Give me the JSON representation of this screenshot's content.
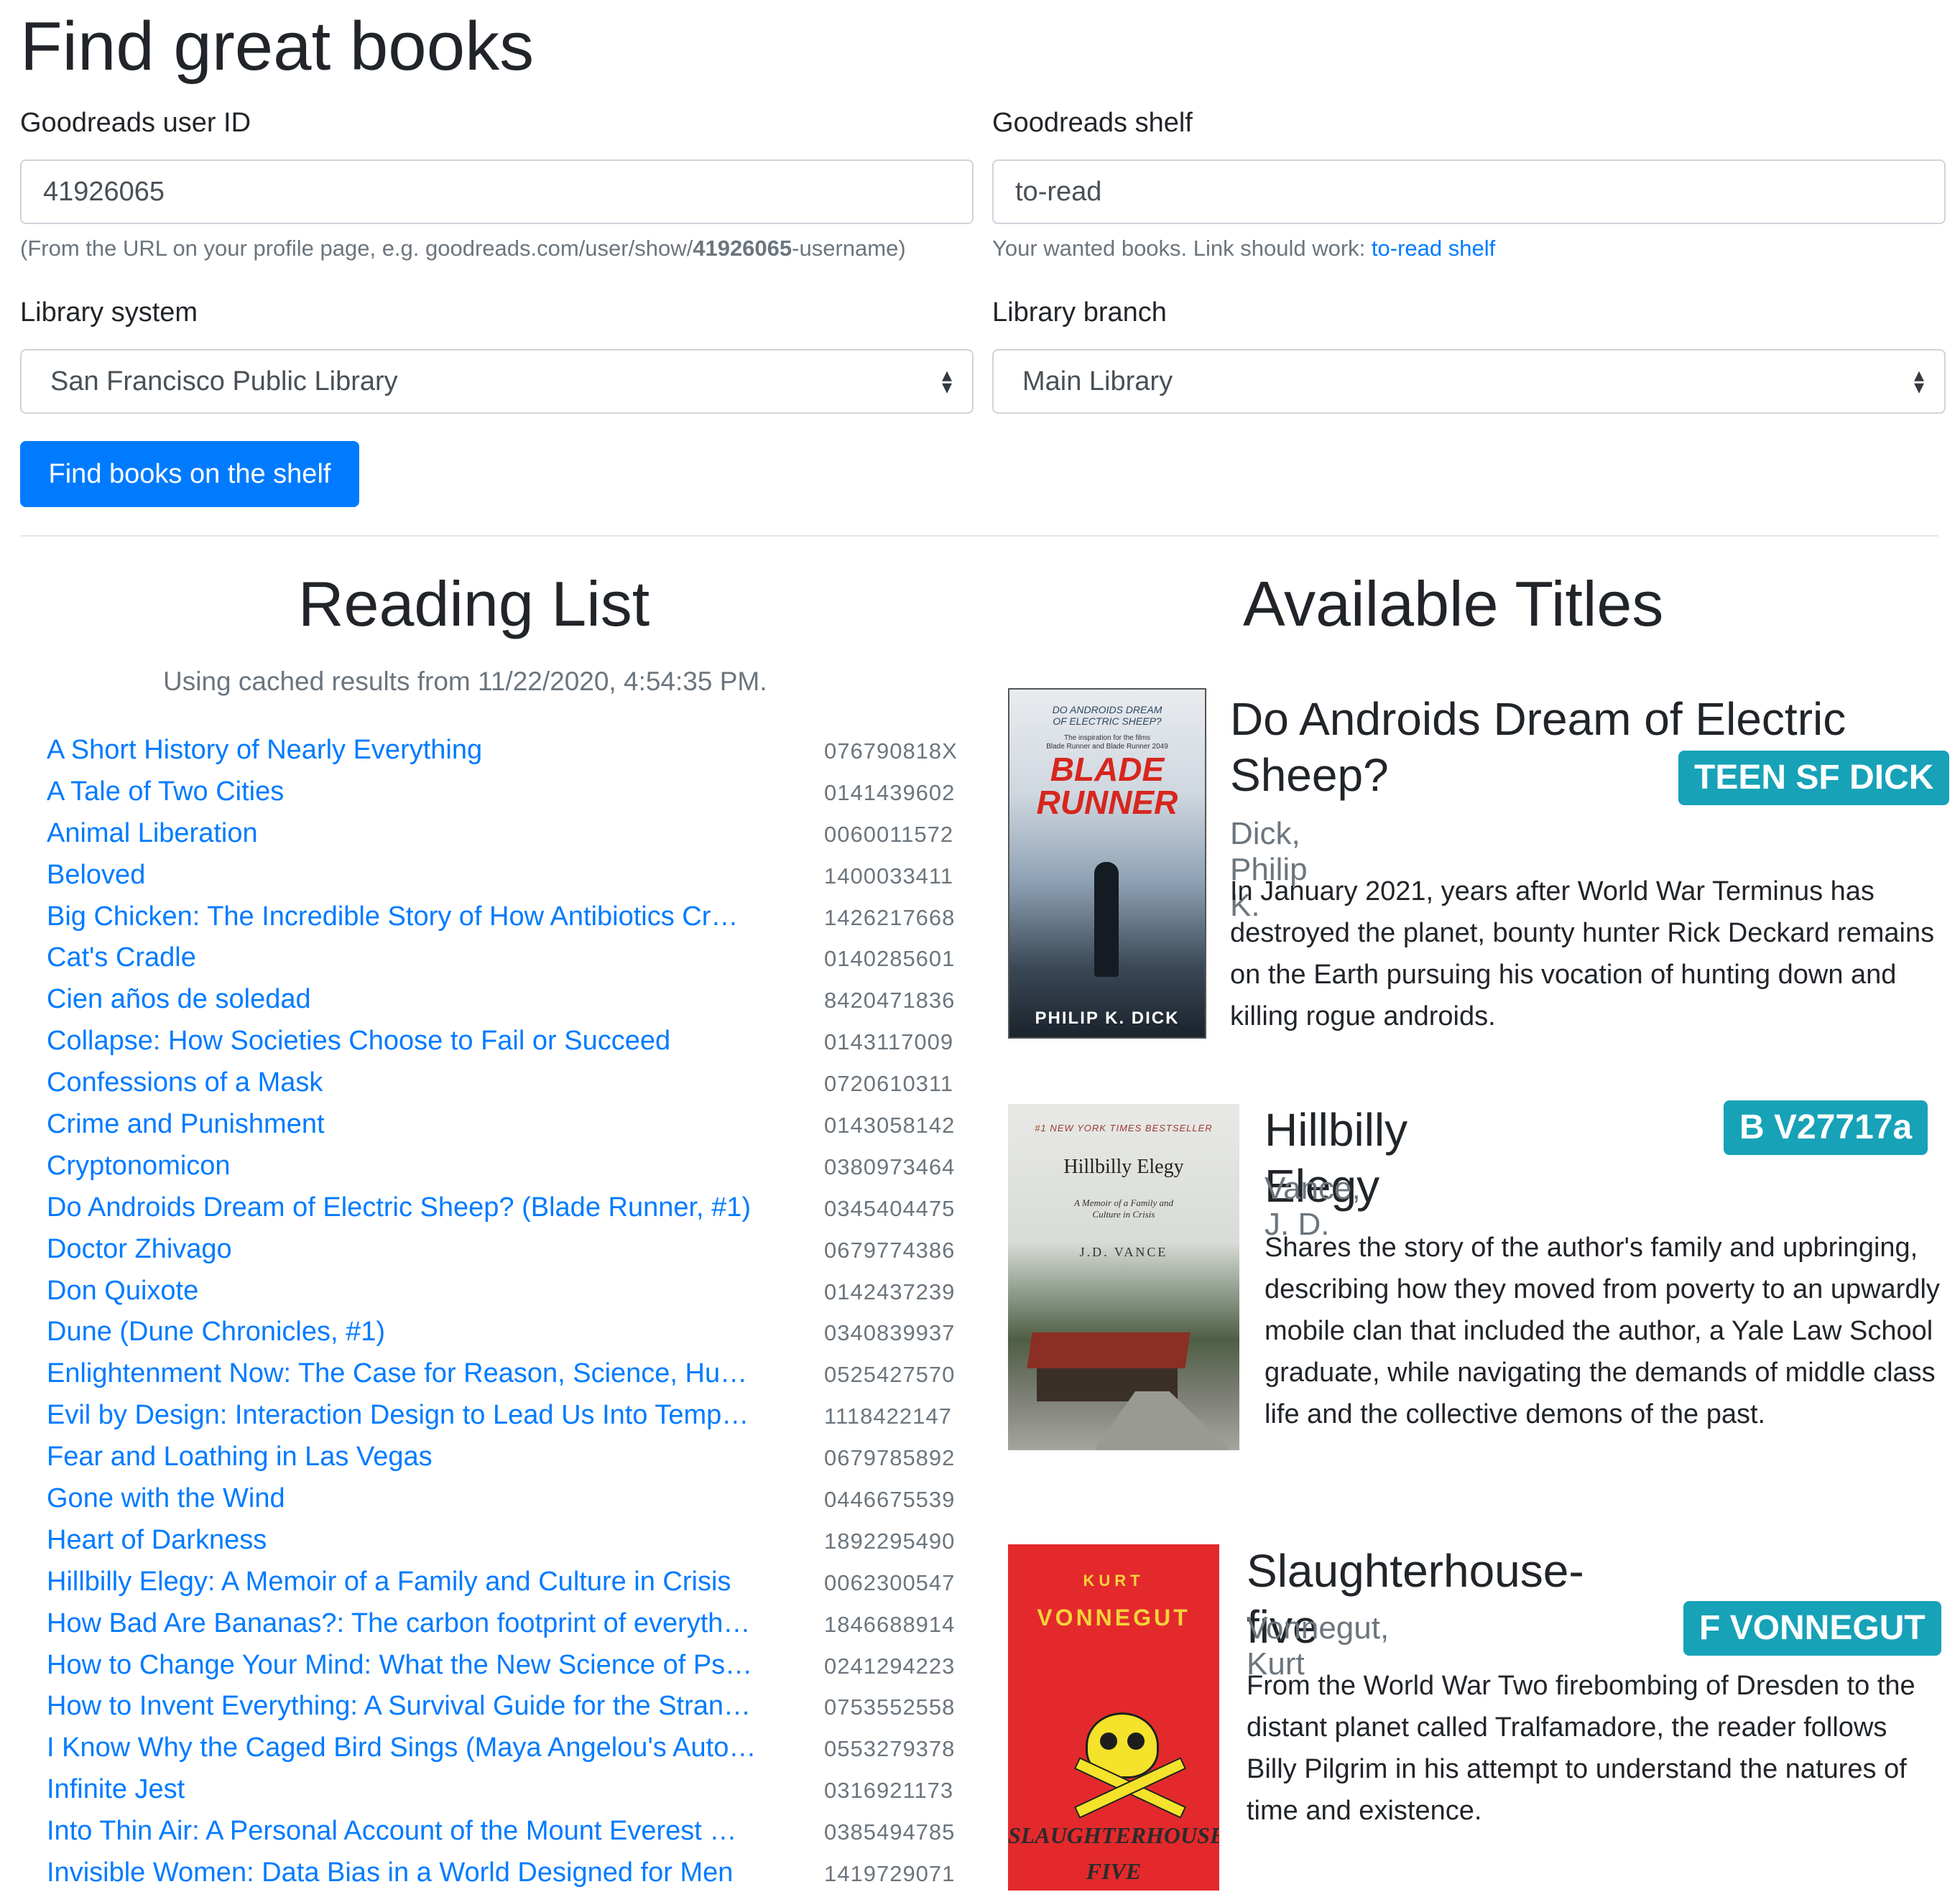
{
  "page_title": "Find great books",
  "form": {
    "user_id_label": "Goodreads user ID",
    "user_id_value": "41926065",
    "user_id_help_prefix": "(From the URL on your profile page, e.g. goodreads.com/user/show/",
    "user_id_help_bold": "41926065",
    "user_id_help_suffix": "-username)",
    "shelf_label": "Goodreads shelf",
    "shelf_value": "to-read",
    "shelf_help_prefix": "Your wanted books. Link should work: ",
    "shelf_help_link": "to-read shelf",
    "system_label": "Library system",
    "system_value": "San Francisco Public Library",
    "branch_label": "Library branch",
    "branch_value": "Main Library",
    "submit_label": "Find books on the shelf"
  },
  "reading_list": {
    "title": "Reading List",
    "cached_note": "Using cached results from 11/22/2020, 4:54:35 PM.",
    "items": [
      {
        "title": "A Short History of Nearly Everything",
        "isbn": "076790818X"
      },
      {
        "title": "A Tale of Two Cities",
        "isbn": "0141439602"
      },
      {
        "title": "Animal Liberation",
        "isbn": "0060011572"
      },
      {
        "title": "Beloved",
        "isbn": "1400033411"
      },
      {
        "title": "Big Chicken: The Incredible Story of How Antibiotics Cr…",
        "isbn": "1426217668"
      },
      {
        "title": "Cat's Cradle",
        "isbn": "0140285601"
      },
      {
        "title": "Cien años de soledad",
        "isbn": "8420471836"
      },
      {
        "title": "Collapse: How Societies Choose to Fail or Succeed",
        "isbn": "0143117009"
      },
      {
        "title": "Confessions of a Mask",
        "isbn": "0720610311"
      },
      {
        "title": "Crime and Punishment",
        "isbn": "0143058142"
      },
      {
        "title": "Cryptonomicon",
        "isbn": "0380973464"
      },
      {
        "title": "Do Androids Dream of Electric Sheep? (Blade Runner, #1)",
        "isbn": "0345404475"
      },
      {
        "title": "Doctor Zhivago",
        "isbn": "0679774386"
      },
      {
        "title": "Don Quixote",
        "isbn": "0142437239"
      },
      {
        "title": "Dune (Dune Chronicles, #1)",
        "isbn": "0340839937"
      },
      {
        "title": "Enlightenment Now: The Case for Reason, Science, Hu…",
        "isbn": "0525427570"
      },
      {
        "title": "Evil by Design: Interaction Design to Lead Us Into Temp…",
        "isbn": "1118422147"
      },
      {
        "title": "Fear and Loathing in Las Vegas",
        "isbn": "0679785892"
      },
      {
        "title": "Gone with the Wind",
        "isbn": "0446675539"
      },
      {
        "title": "Heart of Darkness",
        "isbn": "1892295490"
      },
      {
        "title": "Hillbilly Elegy: A Memoir of a Family and Culture in Crisis",
        "isbn": "0062300547"
      },
      {
        "title": "How Bad Are Bananas?: The carbon footprint of everyth…",
        "isbn": "1846688914"
      },
      {
        "title": "How to Change Your Mind: What the New Science of Ps…",
        "isbn": "0241294223"
      },
      {
        "title": "How to Invent Everything: A Survival Guide for the Stran…",
        "isbn": "0753552558"
      },
      {
        "title": "I Know Why the Caged Bird Sings (Maya Angelou's Auto…",
        "isbn": "0553279378"
      },
      {
        "title": "Infinite Jest",
        "isbn": "0316921173"
      },
      {
        "title": "Into Thin Air: A Personal Account of the Mount Everest …",
        "isbn": "0385494785"
      },
      {
        "title": "Invisible Women: Data Bias in a World Designed for Men",
        "isbn": "1419729071"
      }
    ]
  },
  "available": {
    "title": "Available Titles",
    "books": [
      {
        "title": "Do Androids Dream of Electric Sheep?",
        "author": "Dick, Philip K.",
        "call_number": "TEEN SF DICK",
        "description": "In January 2021, years after World War Terminus has destroyed the planet, bounty hunter Rick Deckard remains on the Earth pursuing his vocation of hunting down and killing rogue androids.",
        "cover": {
          "top_line1": "DO ANDROIDS DREAM",
          "top_line2": "OF ELECTRIC SHEEP?",
          "tag1": "The inspiration for the films",
          "tag2": "Blade Runner and Blade Runner 2049",
          "big1": "BLADE",
          "big2": "RUNNER",
          "author": "PHILIP K. DICK"
        }
      },
      {
        "title": "Hillbilly Elegy",
        "author": "Vance, J. D.",
        "call_number": "B V27717a",
        "description": "Shares the story of the author's family and upbringing, describing how they moved from poverty to an upwardly mobile clan that included the author, a Yale Law School graduate, while navigating the demands of middle class life and the collective demons of the past.",
        "cover": {
          "banner": "#1 NEW YORK TIMES BESTSELLER",
          "title": "Hillbilly Elegy",
          "subtitle1": "A Memoir of a Family and",
          "subtitle2": "Culture in Crisis",
          "author": "J.D. VANCE"
        }
      },
      {
        "title": "Slaughterhouse-five",
        "author": "Vonnegut, Kurt",
        "call_number": "F VONNEGUT",
        "description": "From the World War Two firebombing of Dresden to the distant planet called Tralfamadore, the reader follows Billy Pilgrim in his attempt to understand the natures of time and existence.",
        "cover": {
          "first": "KURT",
          "last": "VONNEGUT",
          "title1": "SLAUGHTERHOUSE-",
          "title2": "FIVE"
        }
      }
    ]
  },
  "colors": {
    "primary": "#007bff",
    "badge": "#17a2b8",
    "muted": "#6c757d",
    "text": "#212529"
  }
}
